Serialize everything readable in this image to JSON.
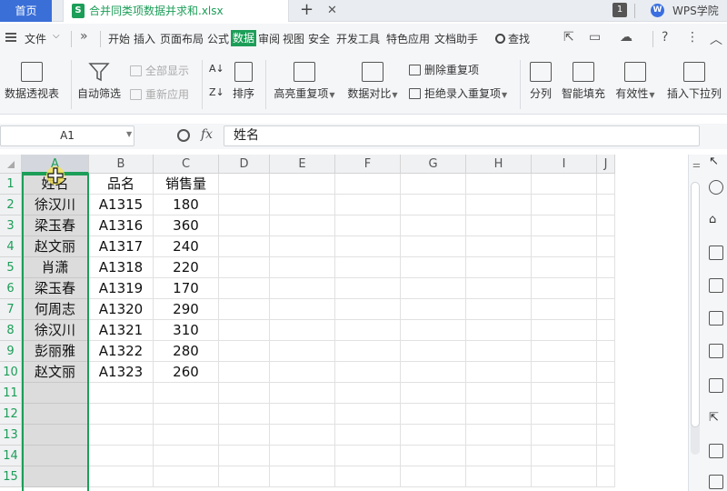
{
  "tabbar": {
    "home_label": "首页",
    "file_icon_letter": "S",
    "file_title": "合并同类项数据并求和.xlsx",
    "close_glyph": "✕",
    "add_glyph": "+",
    "window_count": "1",
    "brand_logo": "W",
    "brand_label": "WPS学院"
  },
  "menubar": {
    "file_label": "文件",
    "more_glyph": "»",
    "tabs": [
      "开始",
      "插入",
      "页面布局",
      "公式",
      "数据",
      "审阅",
      "视图",
      "安全",
      "开发工具",
      "特色应用",
      "文档助手"
    ],
    "active_tab": "数据",
    "search_label": "查找",
    "icons": [
      "share-icon",
      "save-icon",
      "cloud-icon",
      "help-icon",
      "more-icon",
      "collapse-icon"
    ]
  },
  "ribbon": {
    "pivot": "数据透视表",
    "auto_filter": "自动筛选",
    "show_all": "全部显示",
    "reapply": "重新应用",
    "sort": "排序",
    "highlight_dup": "高亮重复项",
    "compare": "数据对比",
    "delete_dup": "删除重复项",
    "reject_dup": "拒绝录入重复项",
    "split": "分列",
    "smart_fill": "智能填充",
    "validity": "有效性",
    "insert_dropdown": "插入下拉列"
  },
  "formula": {
    "cell_ref": "A1",
    "fx": "fx",
    "value": "姓名"
  },
  "sheet": {
    "columns": [
      "A",
      "B",
      "C",
      "D",
      "E",
      "F",
      "G",
      "H",
      "I",
      "J"
    ],
    "selected_column": "A",
    "row_numbers": [
      "1",
      "2",
      "3",
      "4",
      "5",
      "6",
      "7",
      "8",
      "9",
      "10",
      "11",
      "12",
      "13",
      "14",
      "15"
    ],
    "rows": [
      [
        "姓名",
        "品名",
        "销售量"
      ],
      [
        "徐汉川",
        "A1315",
        "180"
      ],
      [
        "梁玉春",
        "A1316",
        "360"
      ],
      [
        "赵文丽",
        "A1317",
        "240"
      ],
      [
        "肖潇",
        "A1318",
        "220"
      ],
      [
        "梁玉春",
        "A1319",
        "170"
      ],
      [
        "何周志",
        "A1320",
        "290"
      ],
      [
        "徐汉川",
        "A1321",
        "310"
      ],
      [
        "彭丽雅",
        "A1322",
        "280"
      ],
      [
        "赵文丽",
        "A1323",
        "260"
      ]
    ]
  },
  "colors": {
    "accent": "#1c9e58",
    "home_tab": "#3a6fd8",
    "selection_fill": "#dcdcdc"
  }
}
